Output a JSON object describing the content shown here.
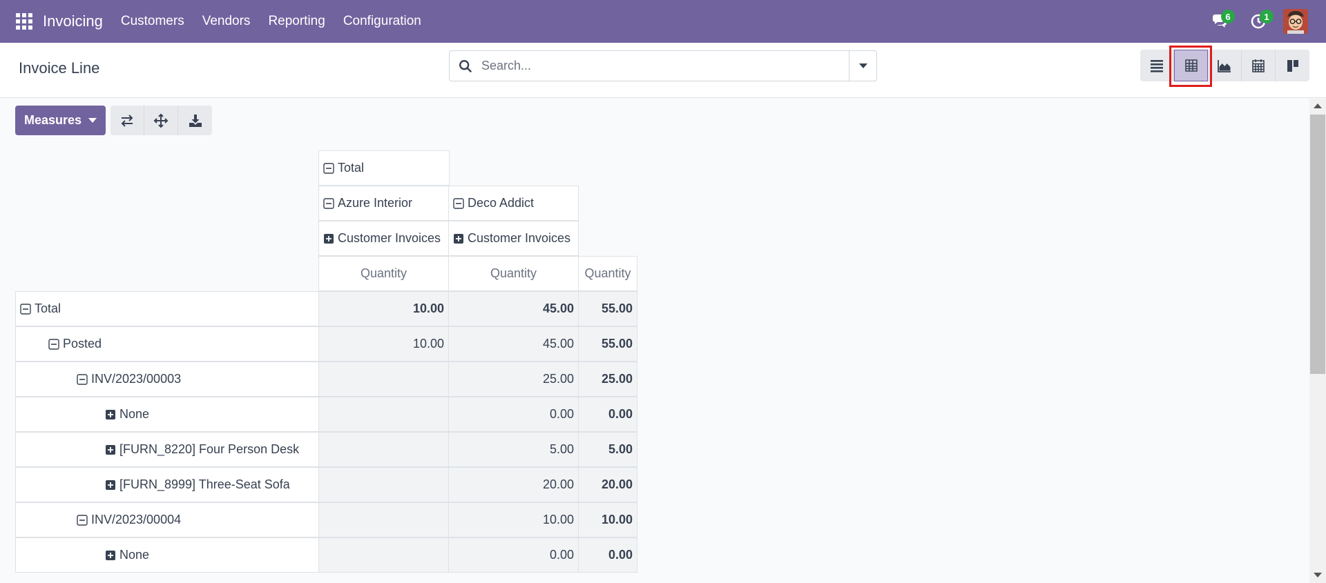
{
  "navbar": {
    "brand": "Invoicing",
    "menu": [
      "Customers",
      "Vendors",
      "Reporting",
      "Configuration"
    ],
    "messages_badge": "6",
    "activities_badge": "1",
    "color": "#71639e"
  },
  "control_panel": {
    "title": "Invoice Line",
    "search_placeholder": "Search...",
    "views": [
      "list-view-icon",
      "pivot-view-icon",
      "graph-view-icon",
      "calendar-view-icon",
      "kanban-view-icon"
    ],
    "active_view": "pivot"
  },
  "toolbar": {
    "measures_label": "Measures",
    "tools": [
      "flip-axis-icon",
      "expand-all-icon",
      "download-icon"
    ]
  },
  "pivot": {
    "col_headers": {
      "total": "Total",
      "partners": [
        "Azure Interior",
        "Deco Addict"
      ],
      "move_types": [
        "Customer Invoices",
        "Customer Invoices"
      ],
      "measure": "Quantity"
    },
    "rows": [
      {
        "label": "Total",
        "azure": "10.00",
        "deco": "45.00",
        "total": "55.00"
      },
      {
        "label": "Posted",
        "azure": "10.00",
        "deco": "45.00",
        "total": "55.00"
      },
      {
        "label": "INV/2023/00003",
        "azure": "",
        "deco": "25.00",
        "total": "25.00"
      },
      {
        "label": "None",
        "azure": "",
        "deco": "0.00",
        "total": "0.00"
      },
      {
        "label": "[FURN_8220] Four Person Desk",
        "azure": "",
        "deco": "5.00",
        "total": "5.00"
      },
      {
        "label": "[FURN_8999] Three-Seat Sofa",
        "azure": "",
        "deco": "20.00",
        "total": "20.00"
      },
      {
        "label": "INV/2023/00004",
        "azure": "",
        "deco": "10.00",
        "total": "10.00"
      },
      {
        "label": "None",
        "azure": "",
        "deco": "0.00",
        "total": "0.00"
      }
    ]
  }
}
